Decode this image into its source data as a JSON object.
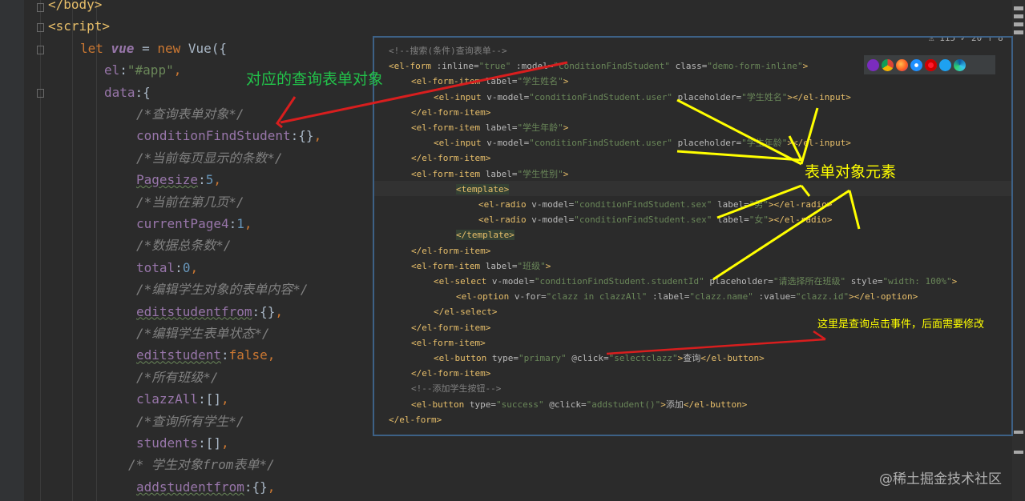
{
  "editor": {
    "lines": [
      {
        "parts": [
          [
            "tag",
            "</body>"
          ]
        ]
      },
      {
        "parts": [
          [
            "tag",
            "<script>"
          ]
        ]
      },
      {
        "parts": [
          [
            "kw",
            "let "
          ],
          [
            "vue",
            "vue"
          ],
          [
            "plain",
            " = "
          ],
          [
            "kw",
            "new "
          ],
          [
            "plain",
            "Vue({"
          ]
        ]
      },
      {
        "parts": [
          [
            "prop",
            "el"
          ],
          [
            "plain",
            ":"
          ],
          [
            "str",
            "\"#app\""
          ],
          [
            "kw",
            ","
          ]
        ]
      },
      {
        "parts": [
          [
            "prop",
            "data"
          ],
          [
            "plain",
            ":{"
          ]
        ]
      },
      {
        "parts": [
          [
            "cm",
            "/*查询表单对象*/"
          ]
        ]
      },
      {
        "parts": [
          [
            "prop",
            "conditionFindStudent"
          ],
          [
            "plain",
            ":{}"
          ],
          [
            "kw",
            ","
          ]
        ]
      },
      {
        "parts": [
          [
            "cm",
            "/*当前每页显示的条数*/"
          ]
        ]
      },
      {
        "parts": [
          [
            "propsq",
            "Pagesize"
          ],
          [
            "plain",
            ":"
          ],
          [
            "num",
            "5"
          ],
          [
            "kw",
            ","
          ]
        ]
      },
      {
        "parts": [
          [
            "cm",
            "/*当前在第几页*/"
          ]
        ]
      },
      {
        "parts": [
          [
            "prop",
            "currentPage4"
          ],
          [
            "plain",
            ":"
          ],
          [
            "num",
            "1"
          ],
          [
            "kw",
            ","
          ]
        ]
      },
      {
        "parts": [
          [
            "cm",
            "/*数据总条数*/"
          ]
        ]
      },
      {
        "parts": [
          [
            "prop",
            "total"
          ],
          [
            "plain",
            ":"
          ],
          [
            "num",
            "0"
          ],
          [
            "kw",
            ","
          ]
        ]
      },
      {
        "parts": [
          [
            "cm",
            "/*编辑学生对象的表单内容*/"
          ]
        ]
      },
      {
        "parts": [
          [
            "propsq",
            "editstudentfrom"
          ],
          [
            "plain",
            ":{}"
          ],
          [
            "kw",
            ","
          ]
        ]
      },
      {
        "parts": [
          [
            "cm",
            "/*编辑学生表单状态*/"
          ]
        ]
      },
      {
        "parts": [
          [
            "propsq",
            "editstudent"
          ],
          [
            "plain",
            ":"
          ],
          [
            "kw",
            "false,"
          ]
        ]
      },
      {
        "parts": [
          [
            "cm",
            "/*所有班级*/"
          ]
        ]
      },
      {
        "parts": [
          [
            "prop",
            "clazzAll"
          ],
          [
            "plain",
            ":[]"
          ],
          [
            "kw",
            ","
          ]
        ]
      },
      {
        "parts": [
          [
            "cm",
            "/*查询所有学生*/"
          ]
        ]
      },
      {
        "parts": [
          [
            "prop",
            "students"
          ],
          [
            "plain",
            ":[]"
          ],
          [
            "kw",
            ","
          ]
        ]
      },
      {
        "parts": [
          [
            "cm",
            "/* 学生对象from表单*/"
          ]
        ]
      },
      {
        "parts": [
          [
            "propsq",
            "addstudentfrom"
          ],
          [
            "plain",
            ":{}"
          ],
          [
            "kw",
            ","
          ]
        ]
      }
    ]
  },
  "overlay": {
    "counter": "⚠ 115 ✓ 20 ↑ 8",
    "lines": [
      [
        [
          "c",
          "<!--搜索(条件)查询表单-->"
        ]
      ],
      [
        [
          "t",
          "<el-form"
        ],
        [
          "a",
          " :inline="
        ],
        [
          "s",
          "\"true\""
        ],
        [
          "a",
          " :model="
        ],
        [
          "s",
          "\"conditionFindStudent\""
        ],
        [
          "a",
          " class="
        ],
        [
          "s",
          "\"demo-form-inline\""
        ],
        [
          "t",
          ">"
        ]
      ],
      [
        [
          "t",
          "<el-form-item"
        ],
        [
          "a",
          " label="
        ],
        [
          "s",
          "\"学生姓名\""
        ],
        [
          "t",
          ">"
        ]
      ],
      [
        [
          "t",
          "<el-input"
        ],
        [
          "a",
          " v-model="
        ],
        [
          "s",
          "\"conditionFindStudent.user\""
        ],
        [
          "a",
          " placeholder="
        ],
        [
          "s",
          "\"学生姓名\""
        ],
        [
          "t",
          "></el-input>"
        ]
      ],
      [
        [
          "t",
          "</el-form-item>"
        ]
      ],
      [
        [
          "t",
          "<el-form-item"
        ],
        [
          "a",
          " label="
        ],
        [
          "s",
          "\"学生年龄\""
        ],
        [
          "t",
          ">"
        ]
      ],
      [
        [
          "t",
          "<el-input"
        ],
        [
          "a",
          " v-model="
        ],
        [
          "s",
          "\"conditionFindStudent.user\""
        ],
        [
          "a",
          " placeholder="
        ],
        [
          "s",
          "\"学生年龄\""
        ],
        [
          "t",
          "></el-input>"
        ]
      ],
      [
        [
          "t",
          "</el-form-item>"
        ]
      ],
      [
        [
          "t",
          "<el-form-item"
        ],
        [
          "a",
          " label="
        ],
        [
          "s",
          "\"学生性别\""
        ],
        [
          "t",
          ">"
        ]
      ],
      [
        [
          "t",
          "<template>"
        ]
      ],
      [
        [
          "t",
          "<el-radio"
        ],
        [
          "a",
          " v-model="
        ],
        [
          "s",
          "\"conditionFindStudent.sex\""
        ],
        [
          "a",
          " label="
        ],
        [
          "s",
          "\"男\""
        ],
        [
          "t",
          "></el-radio>"
        ]
      ],
      [
        [
          "t",
          "<el-radio"
        ],
        [
          "a",
          " v-model="
        ],
        [
          "s",
          "\"conditionFindStudent.sex\""
        ],
        [
          "a",
          " label="
        ],
        [
          "s",
          "\"女\""
        ],
        [
          "t",
          "></el-radio>"
        ]
      ],
      [
        [
          "t",
          "</template>"
        ]
      ],
      [
        [
          "t",
          "</el-form-item>"
        ]
      ],
      [
        [
          "t",
          "<el-form-item"
        ],
        [
          "a",
          " label="
        ],
        [
          "s",
          "\"班级\""
        ],
        [
          "t",
          ">"
        ]
      ],
      [
        [
          "t",
          "<el-select"
        ],
        [
          "a",
          " v-model="
        ],
        [
          "s",
          "\"conditionFindStudent.studentId\""
        ],
        [
          "a",
          " placeholder="
        ],
        [
          "s",
          "\"请选择所在班级\""
        ],
        [
          "a",
          " style="
        ],
        [
          "s",
          "\"width: 100%\""
        ],
        [
          "t",
          ">"
        ]
      ],
      [
        [
          "t",
          "<el-option"
        ],
        [
          "a",
          " v-for="
        ],
        [
          "s",
          "\"clazz in clazzAll\""
        ],
        [
          "a",
          " :label="
        ],
        [
          "s",
          "\"clazz.name\""
        ],
        [
          "a",
          " :value="
        ],
        [
          "s",
          "\"clazz.id\""
        ],
        [
          "t",
          "></el-option>"
        ]
      ],
      [
        [
          "t",
          "</el-select>"
        ]
      ],
      [
        [
          "t",
          "</el-form-item>"
        ]
      ],
      [
        [
          "t",
          "<el-form-item>"
        ]
      ],
      [
        [
          "t",
          "<el-button"
        ],
        [
          "a",
          " type="
        ],
        [
          "s",
          "\"primary\""
        ],
        [
          "a",
          " @click="
        ],
        [
          "s",
          "\"selectclazz\""
        ],
        [
          "t",
          ">"
        ],
        [
          "a",
          "查询"
        ],
        [
          "t",
          "</el-button>"
        ]
      ],
      [
        [
          "t",
          "</el-form-item>"
        ]
      ],
      [
        [
          "c",
          "<!--添加学生按钮-->"
        ]
      ],
      [
        [
          "t",
          "<el-button"
        ],
        [
          "a",
          " type="
        ],
        [
          "s",
          "\"success\""
        ],
        [
          "a",
          " @click="
        ],
        [
          "s",
          "\"addstudent()\""
        ],
        [
          "t",
          ">"
        ],
        [
          "a",
          "添加"
        ],
        [
          "t",
          "</el-button>"
        ]
      ],
      [
        [
          "t",
          "</el-form>"
        ]
      ]
    ]
  },
  "annotations": {
    "form_object": "对应的查询表单对象",
    "form_elements": "表单对象元素",
    "click_event": "这里是查询点击事件，后面需要修改"
  },
  "watermark": "@稀土掘金技术社区",
  "colors": {
    "arrow_red": "#d81e1e",
    "arrow_yellow": "#ffff00",
    "annot_green": "#22c24a"
  }
}
